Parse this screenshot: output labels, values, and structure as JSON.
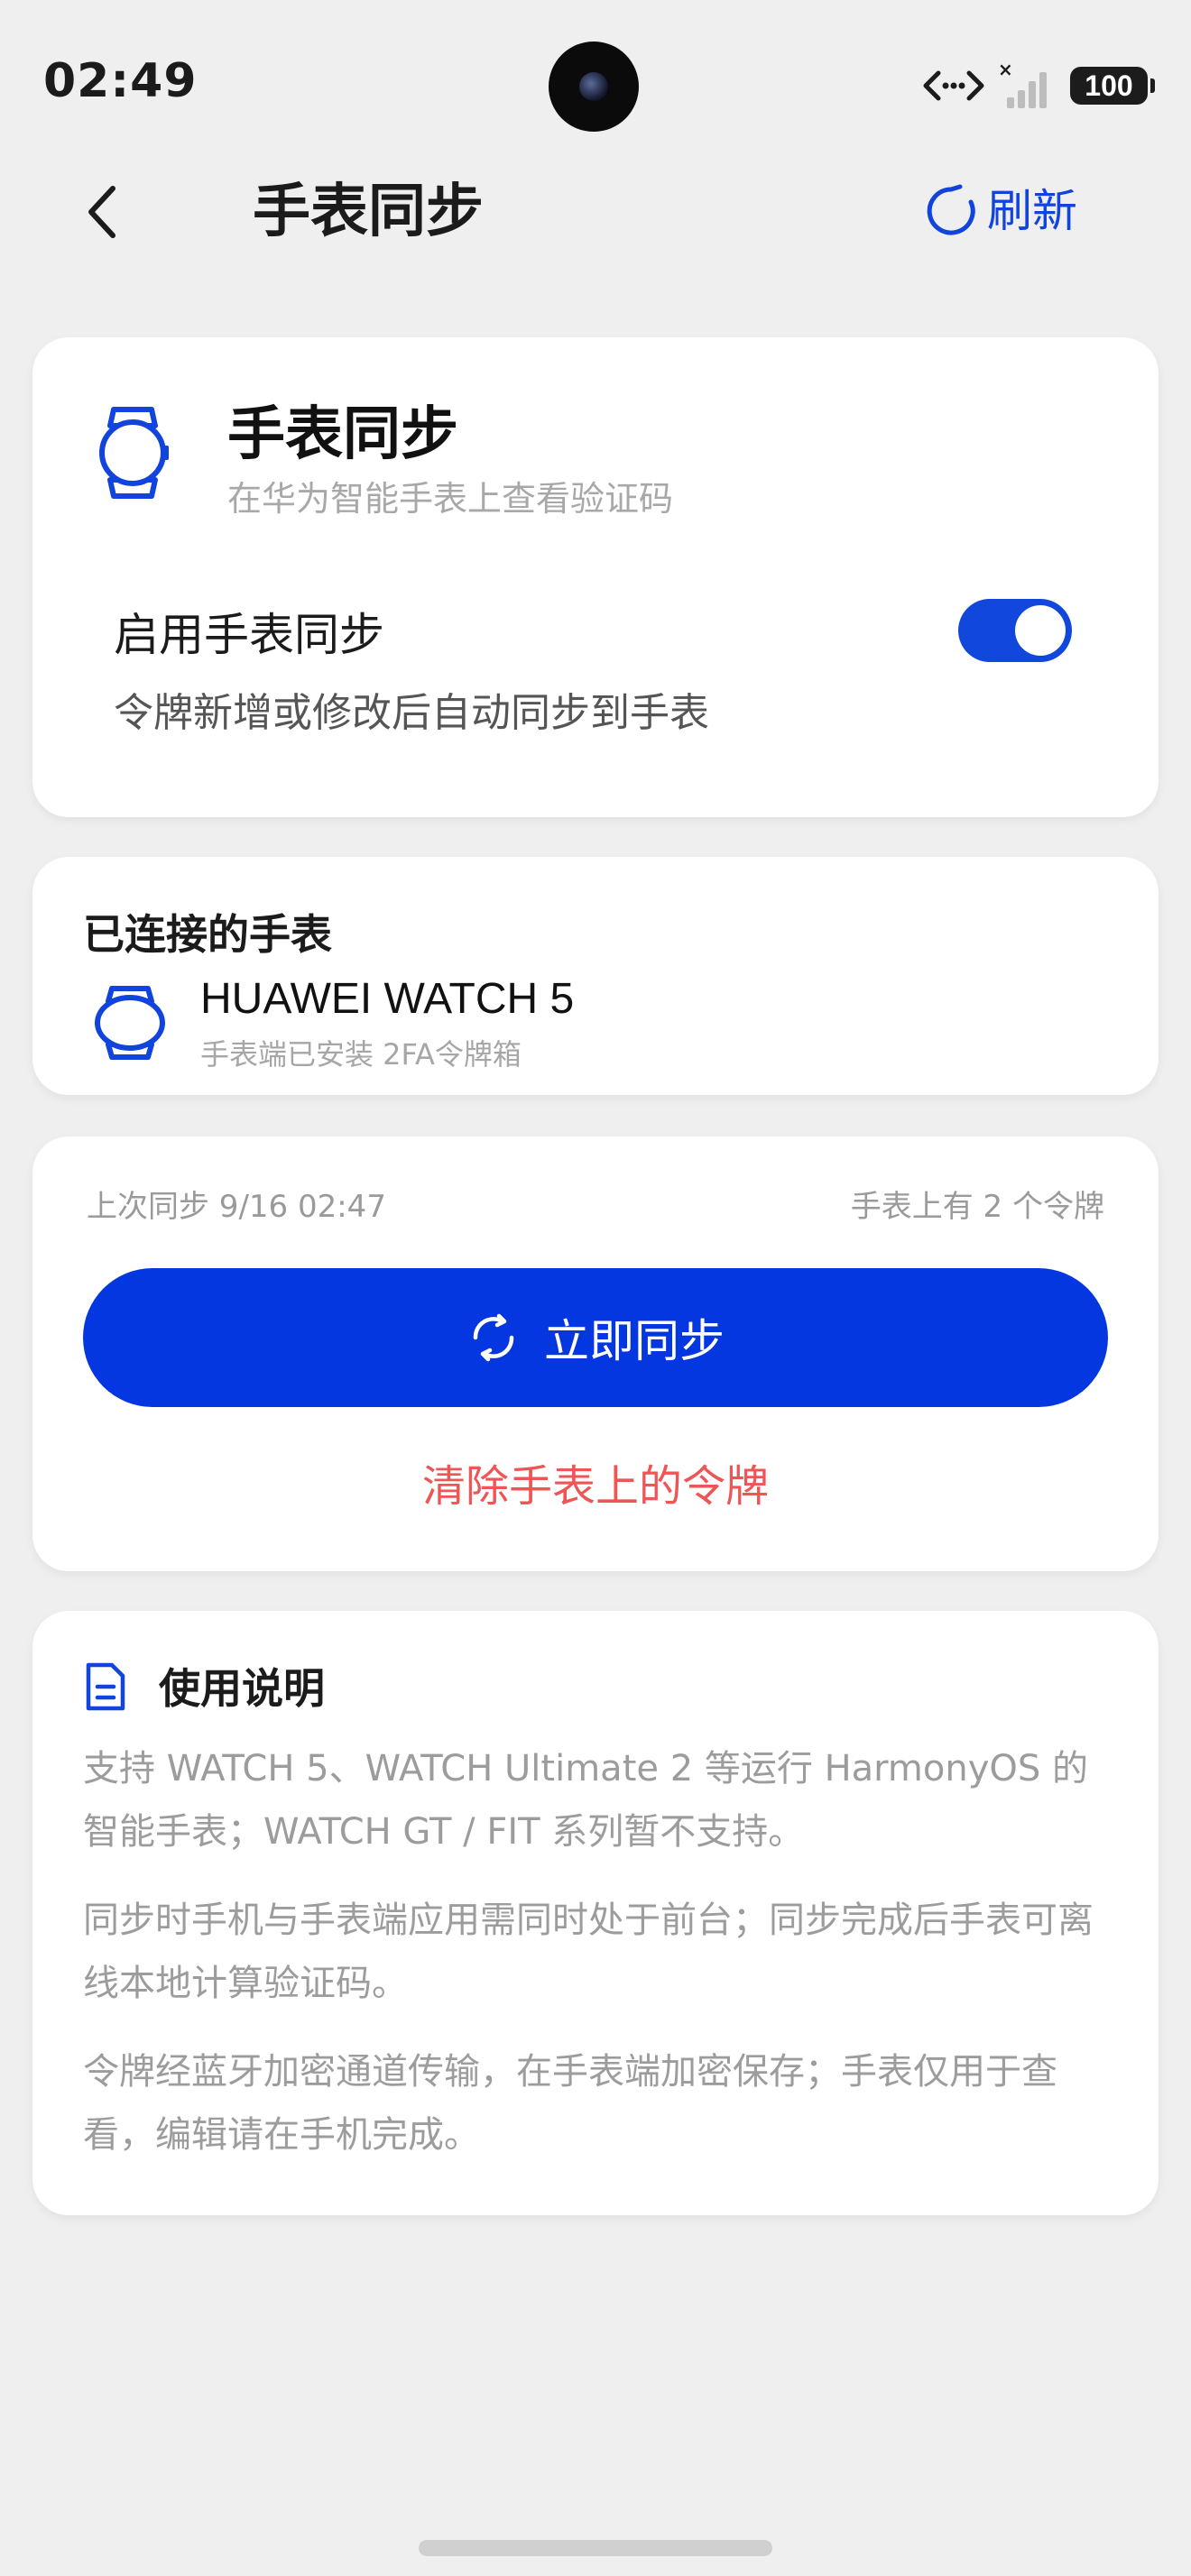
{
  "status_bar": {
    "time": "02:49",
    "battery": "100",
    "icons": [
      "signal-arrows-icon",
      "no-signal-icon",
      "battery-icon"
    ]
  },
  "header": {
    "title": "手表同步",
    "refresh_label": "刷新"
  },
  "watch_sync_card": {
    "title": "手表同步",
    "subtitle": "在华为智能手表上查看验证码",
    "toggle_label": "启用手表同步",
    "toggle_desc": "令牌新增或修改后自动同步到手表",
    "toggle_on": true
  },
  "connected_card": {
    "heading": "已连接的手表",
    "device_name": "HUAWEI WATCH 5",
    "device_sub": "手表端已安装 2FA令牌箱"
  },
  "sync_card": {
    "last_sync": "上次同步 9/16 02:47",
    "token_count": "手表上有 2 个令牌",
    "sync_button": "立即同步",
    "clear_link": "清除手表上的令牌"
  },
  "usage_card": {
    "title": "使用说明",
    "paragraphs": [
      "支持 WATCH 5、WATCH Ultimate 2 等运行 HarmonyOS 的智能手表；WATCH GT / FIT 系列暂不支持。",
      "同步时手机与手表端应用需同时处于前台；同步完成后手表可离线本地计算验证码。",
      "令牌经蓝牙加密通道传输，在手表端加密保存；手表仅用于查看，编辑请在手机完成。"
    ]
  },
  "colors": {
    "accent": "#0437e0",
    "link_blue": "#1144dd",
    "danger": "#ee5555",
    "background": "#efefef"
  }
}
